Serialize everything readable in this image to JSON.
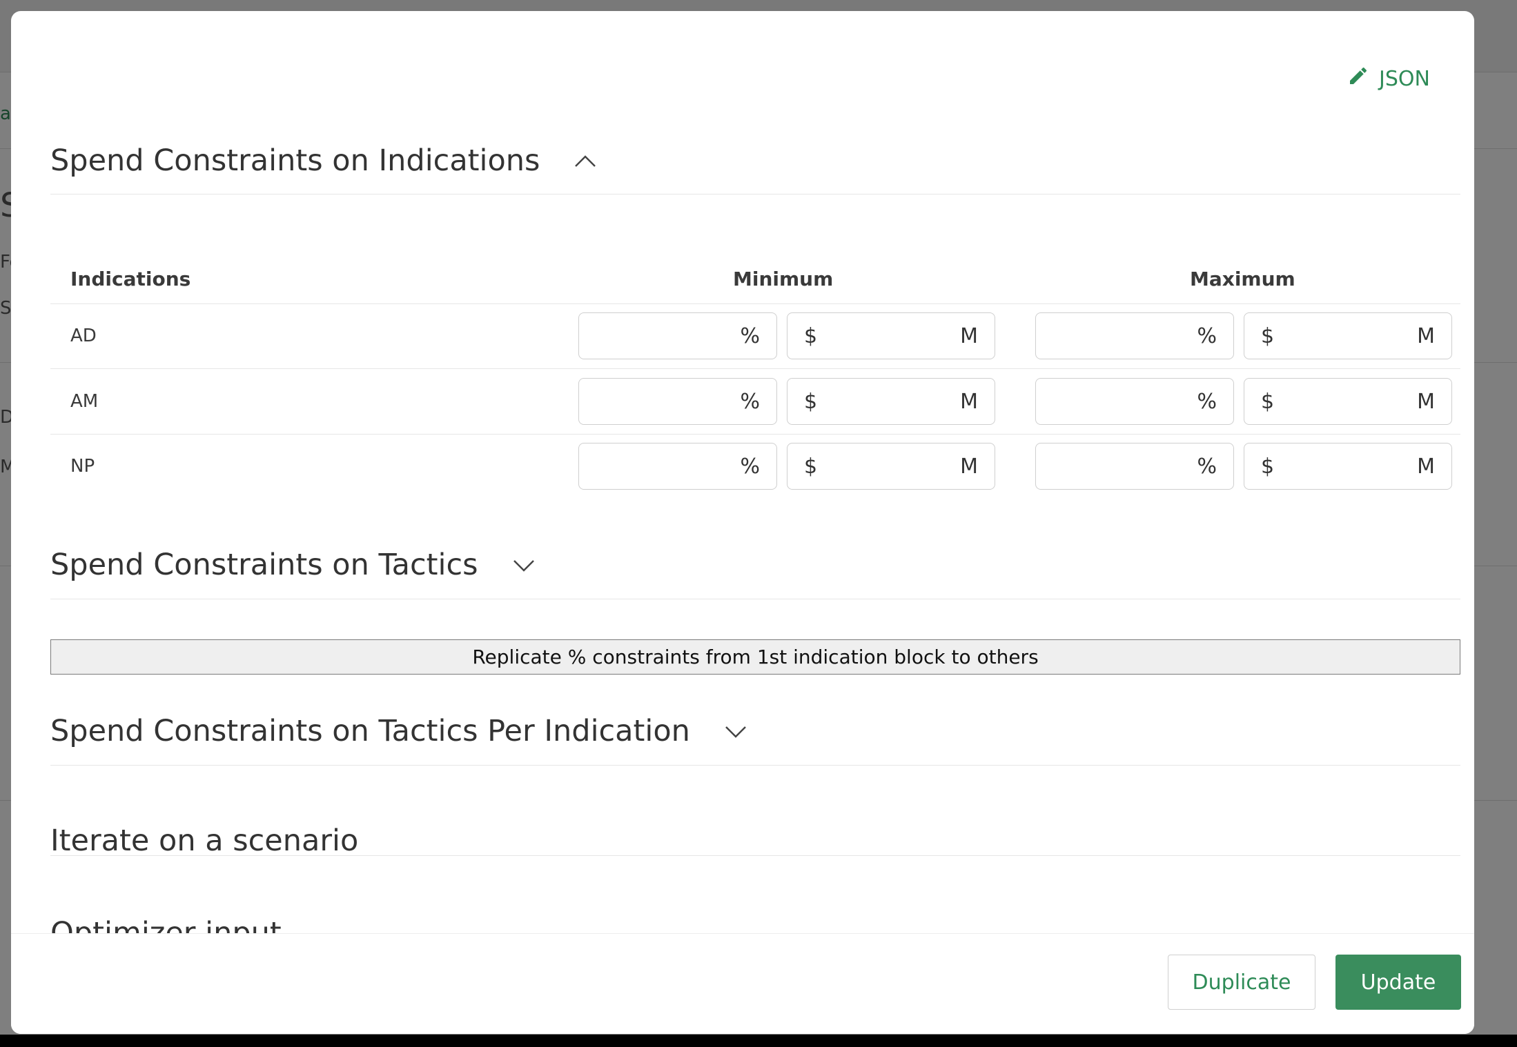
{
  "modal": {
    "json_button": {
      "label": "JSON",
      "icon": "pencil-icon"
    },
    "sections": {
      "indications": {
        "title": "Spend Constraints on Indications",
        "expanded": true,
        "table": {
          "headers": {
            "indications": "Indications",
            "minimum": "Minimum",
            "maximum": "Maximum"
          },
          "rows": [
            {
              "label": "AD",
              "min_pct": "",
              "min_usd": "",
              "max_pct": "",
              "max_usd": ""
            },
            {
              "label": "AM",
              "min_pct": "",
              "min_usd": "",
              "max_pct": "",
              "max_usd": ""
            },
            {
              "label": "NP",
              "min_pct": "",
              "min_usd": "",
              "max_pct": "",
              "max_usd": ""
            }
          ],
          "units": {
            "percent": "%",
            "dollar": "$",
            "million": "M"
          }
        }
      },
      "tactics": {
        "title": "Spend Constraints on Tactics",
        "expanded": false
      },
      "replicate_button": {
        "label": "Replicate % constraints from 1st indication block to others"
      },
      "tactics_per_indication": {
        "title": "Spend Constraints on Tactics Per Indication",
        "expanded": false
      },
      "iterate": {
        "title": "Iterate on a scenario"
      },
      "optimizer": {
        "title": "Optimizer input"
      }
    },
    "footer": {
      "duplicate_label": "Duplicate",
      "update_label": "Update"
    }
  },
  "background": {
    "fragments": [
      "S",
      "Fe",
      "Si",
      "D",
      "M",
      "ac"
    ]
  },
  "colors": {
    "accent": "#2e8b57",
    "primary_button": "#3a8d5d",
    "overlay": "rgba(0,0,0,0.5)"
  }
}
